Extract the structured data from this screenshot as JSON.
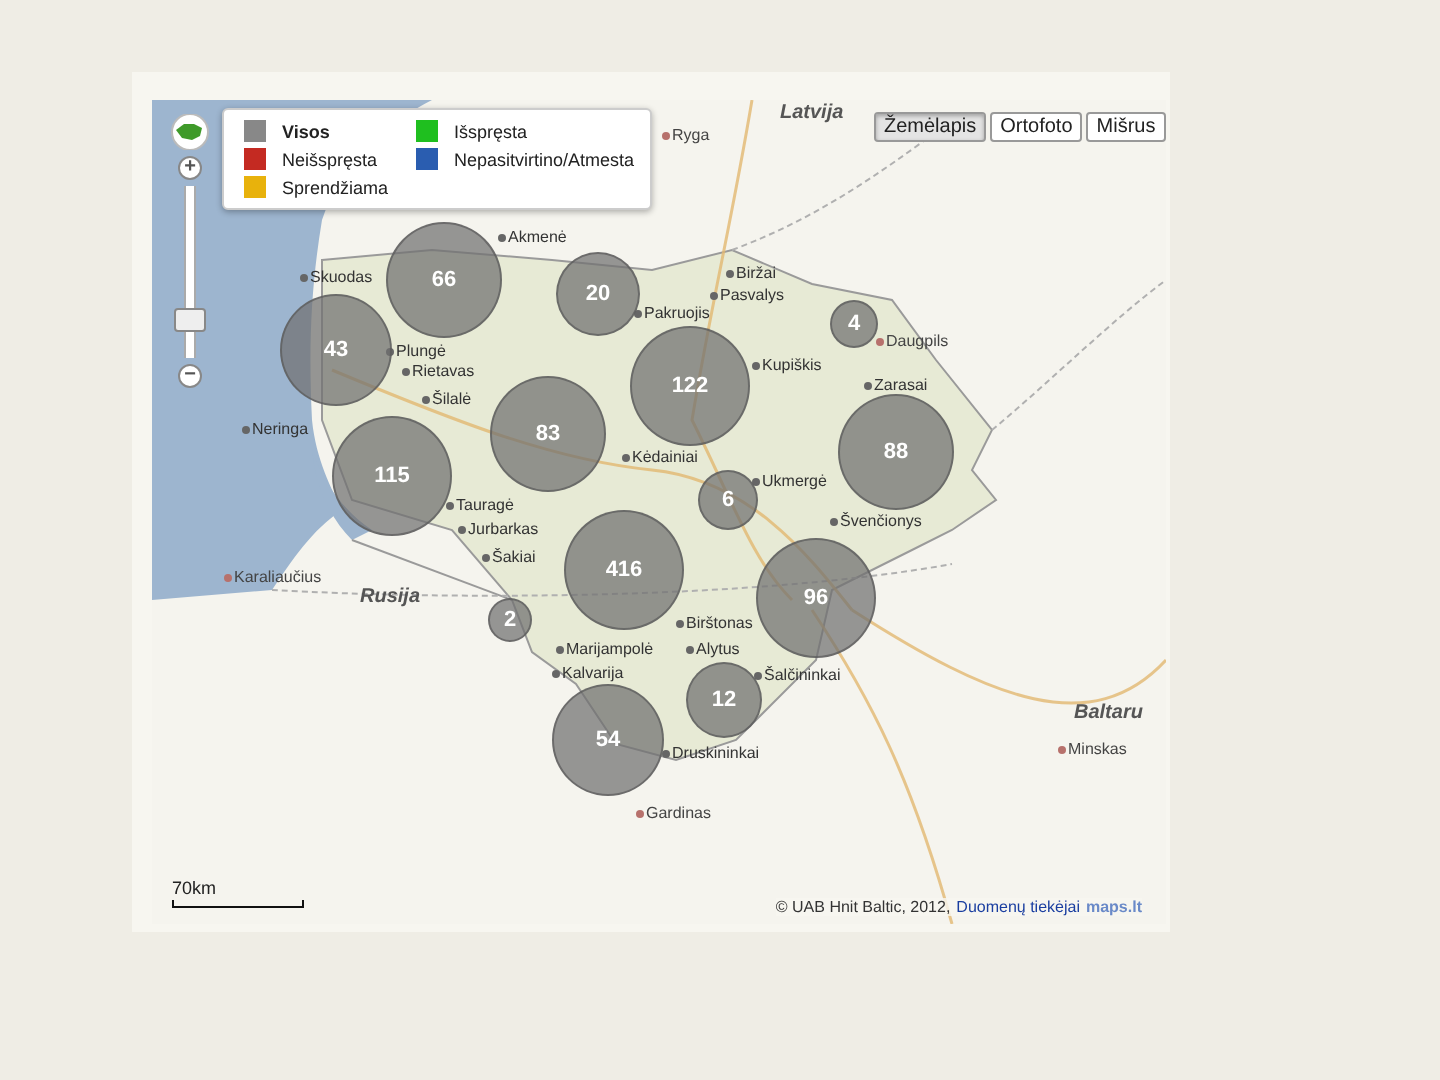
{
  "legend": [
    {
      "label": "Visos",
      "color": "#888888",
      "selected": true
    },
    {
      "label": "Išspręsta",
      "color": "#1fbf1f",
      "selected": false
    },
    {
      "label": "Neišspręsta",
      "color": "#c42a22",
      "selected": false
    },
    {
      "label": "Nepasitvirtino/Atmesta",
      "color": "#2a5db0",
      "selected": false
    },
    {
      "label": "Sprendžiama",
      "color": "#e8b20c",
      "selected": false
    }
  ],
  "zoom": {
    "in": "+",
    "out": "−",
    "level": 0.2
  },
  "map_types": [
    {
      "label": "Žemėlapis",
      "selected": true
    },
    {
      "label": "Ortofoto",
      "selected": false
    },
    {
      "label": "Mišrus",
      "selected": false
    }
  ],
  "places": [
    {
      "name": "Latvija",
      "kind": "country"
    },
    {
      "name": "Ryga",
      "kind": "foreign-city"
    },
    {
      "name": "Skuodas",
      "kind": "city"
    },
    {
      "name": "Akmenė",
      "kind": "city"
    },
    {
      "name": "Plungė",
      "kind": "city"
    },
    {
      "name": "Rietavas",
      "kind": "city"
    },
    {
      "name": "Biržai",
      "kind": "city"
    },
    {
      "name": "Pasvalys",
      "kind": "city"
    },
    {
      "name": "Pakruojis",
      "kind": "city"
    },
    {
      "name": "Kupiškis",
      "kind": "city"
    },
    {
      "name": "Daugpils",
      "kind": "foreign-city"
    },
    {
      "name": "Zarasai",
      "kind": "city"
    },
    {
      "name": "Neringa",
      "kind": "city"
    },
    {
      "name": "Šilalė",
      "kind": "city"
    },
    {
      "name": "Tauragė",
      "kind": "city"
    },
    {
      "name": "Kėdainiai",
      "kind": "city"
    },
    {
      "name": "Ukmergė",
      "kind": "city"
    },
    {
      "name": "Švenčionys",
      "kind": "city"
    },
    {
      "name": "Jurbarkas",
      "kind": "city"
    },
    {
      "name": "Šakiai",
      "kind": "city"
    },
    {
      "name": "Karaliaučius",
      "kind": "foreign-city"
    },
    {
      "name": "Rusija",
      "kind": "country"
    },
    {
      "name": "Marijampolė",
      "kind": "city"
    },
    {
      "name": "Birštonas",
      "kind": "city"
    },
    {
      "name": "Alytus",
      "kind": "city"
    },
    {
      "name": "Šalčininkai",
      "kind": "city"
    },
    {
      "name": "Kalvarija",
      "kind": "city"
    },
    {
      "name": "Druskininkai",
      "kind": "city"
    },
    {
      "name": "Baltaru",
      "kind": "country"
    },
    {
      "name": "Minskas",
      "kind": "foreign-city"
    },
    {
      "name": "Gardinas",
      "kind": "foreign-city"
    }
  ],
  "clusters": [
    {
      "count": "66"
    },
    {
      "count": "20"
    },
    {
      "count": "43"
    },
    {
      "count": "122"
    },
    {
      "count": "4"
    },
    {
      "count": "83"
    },
    {
      "count": "88"
    },
    {
      "count": "115"
    },
    {
      "count": "6"
    },
    {
      "count": "416"
    },
    {
      "count": "96"
    },
    {
      "count": "2"
    },
    {
      "count": "12"
    },
    {
      "count": "54"
    }
  ],
  "scale": "70km",
  "attribution": {
    "text": "© UAB Hnit Baltic, 2012,",
    "link": "Duomenų tiekėjai",
    "logo": "maps.lt"
  }
}
